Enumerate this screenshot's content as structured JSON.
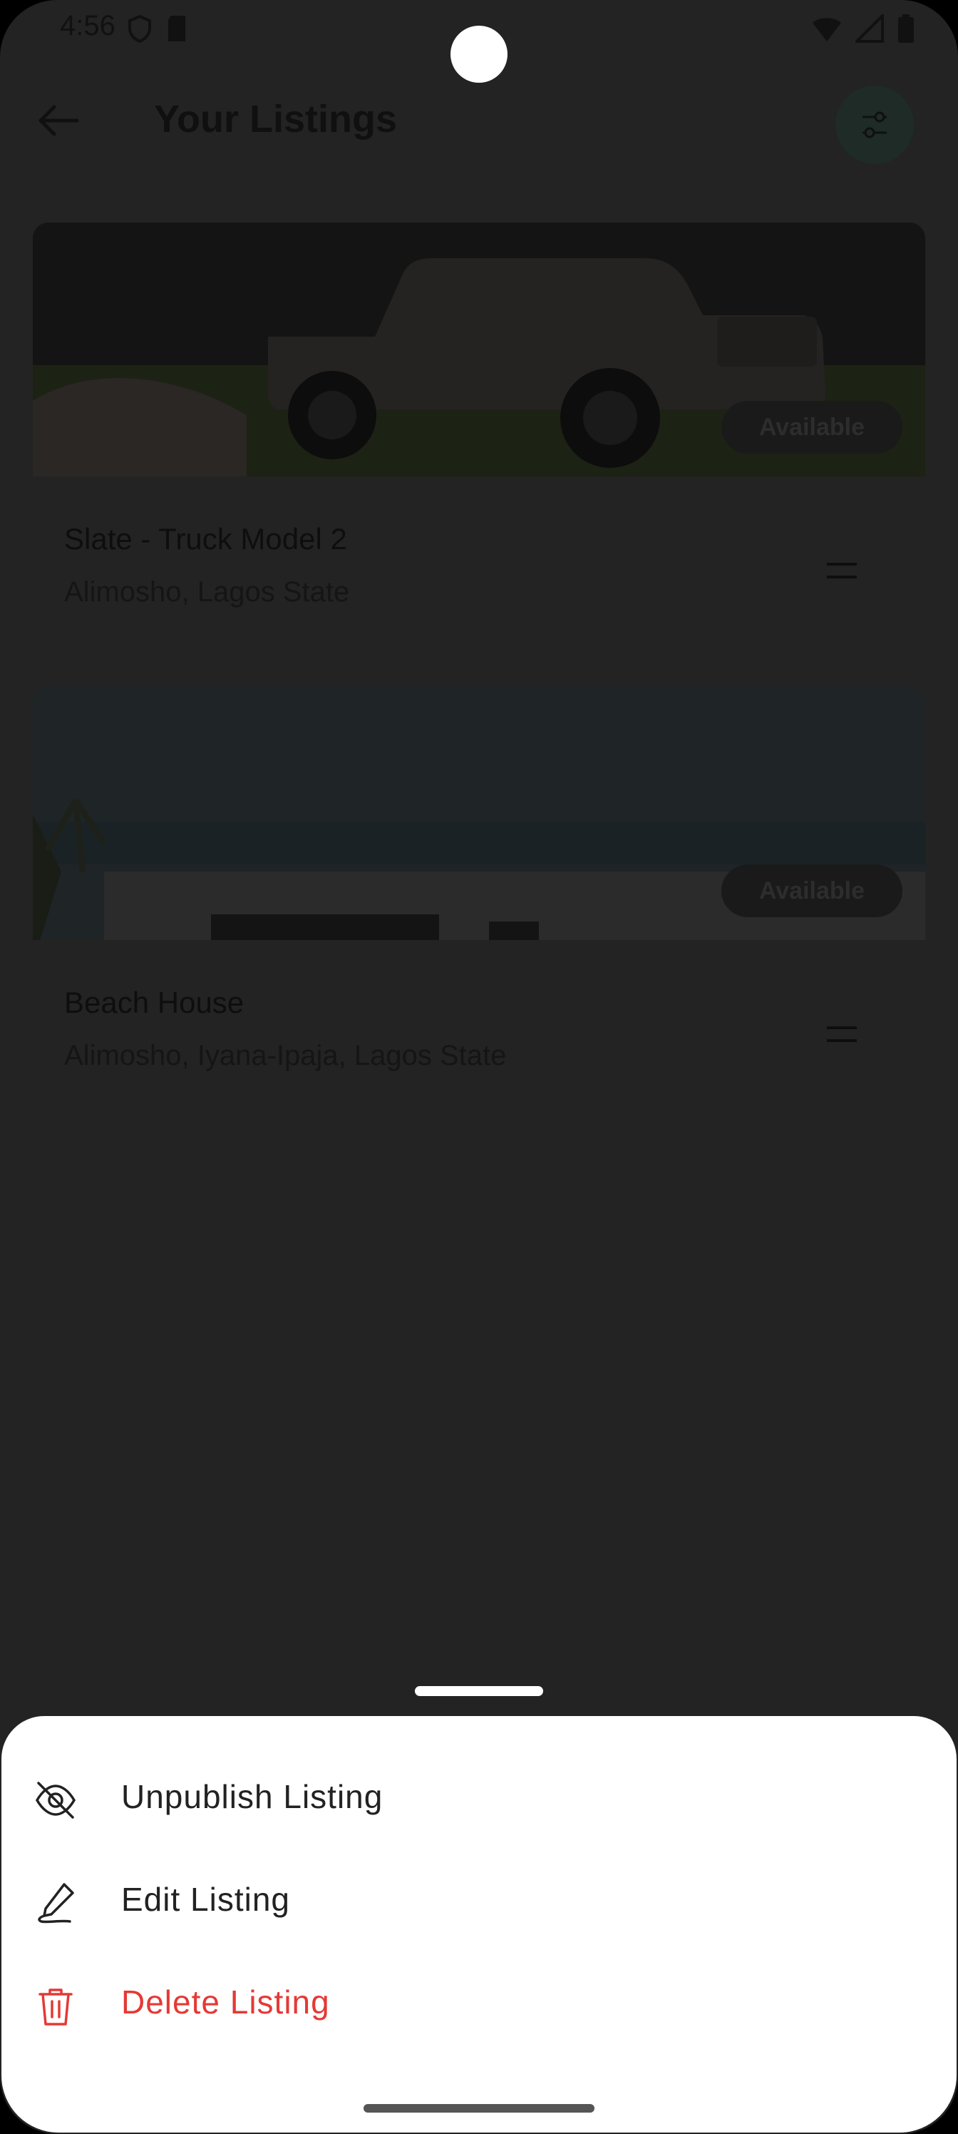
{
  "status": {
    "time": "4:56"
  },
  "header": {
    "title": "Your Listings"
  },
  "listings": [
    {
      "title": "Slate  -  Truck Model 2",
      "location": "Alimosho, Lagos State",
      "badge": "Available"
    },
    {
      "title": "Beach House",
      "location": "Alimosho, Iyana-Ipaja, Lagos State",
      "badge": "Available"
    }
  ],
  "sheet": {
    "items": [
      {
        "label": "Unpublish Listing",
        "icon": "eye-off-icon"
      },
      {
        "label": "Edit Listing",
        "icon": "pen-icon"
      },
      {
        "label": "Delete Listing",
        "icon": "trash-icon",
        "color": "#e53935"
      }
    ]
  }
}
